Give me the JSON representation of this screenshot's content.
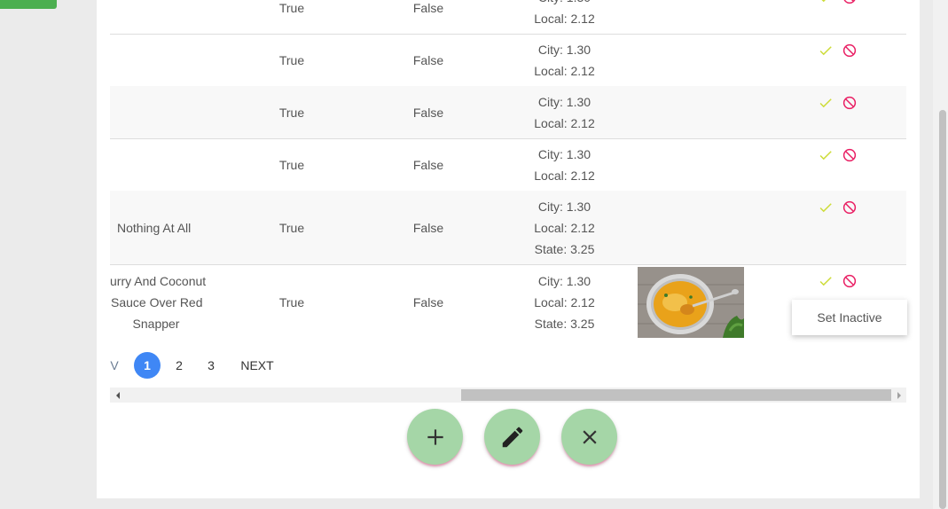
{
  "rows": [
    {
      "name": [],
      "active": "True",
      "featured": "False",
      "tax": [
        "City: 1.30",
        "Local: 2.12"
      ],
      "image": false
    },
    {
      "name": [],
      "active": "True",
      "featured": "False",
      "tax": [
        "City: 1.30",
        "Local: 2.12"
      ],
      "image": false
    },
    {
      "name": [],
      "active": "True",
      "featured": "False",
      "tax": [
        "City: 1.30",
        "Local: 2.12"
      ],
      "image": false
    },
    {
      "name": [],
      "active": "True",
      "featured": "False",
      "tax": [
        "City: 1.30",
        "Local: 2.12"
      ],
      "image": false
    },
    {
      "name": [
        "Nothing At All"
      ],
      "active": "True",
      "featured": "False",
      "tax": [
        "City: 1.30",
        "Local: 2.12",
        "State: 3.25"
      ],
      "image": false
    },
    {
      "name": [
        "urry And Coconut",
        "Sauce Over Red",
        "Snapper"
      ],
      "active": "True",
      "featured": "False",
      "tax": [
        "City: 1.30",
        "Local: 2.12",
        "State: 3.25"
      ],
      "image": true
    }
  ],
  "actions": {
    "activate_icon": "check-icon",
    "deactivate_icon": "block-icon"
  },
  "tooltip": {
    "label": "Set Inactive"
  },
  "pagination": {
    "prev": "V",
    "pages": [
      "1",
      "2",
      "3"
    ],
    "current": "1",
    "next": "NEXT"
  },
  "fabs": {
    "add_icon": "plus-icon",
    "edit_icon": "pencil-icon",
    "close_icon": "close-icon"
  },
  "colors": {
    "check": "#cddc39",
    "block": "#e91e63",
    "fab": "#a5d6a7",
    "page_active": "#3f87f5",
    "accent_green": "#4caf50"
  }
}
